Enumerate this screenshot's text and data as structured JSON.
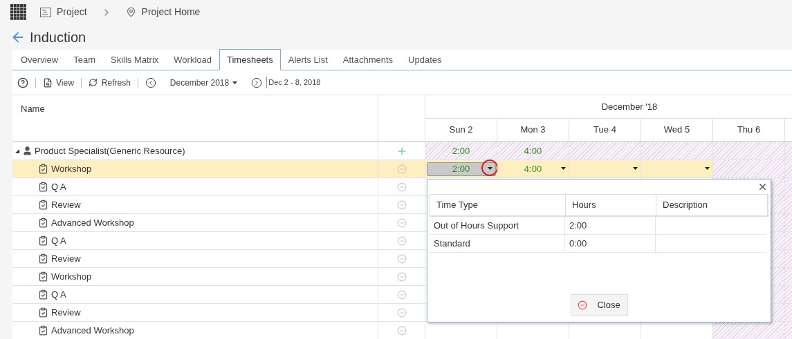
{
  "breadcrumb": [
    {
      "label": "Project",
      "kind": "project"
    },
    {
      "label": "Project Home",
      "kind": "home"
    }
  ],
  "title": "Induction",
  "tabs": [
    {
      "label": "Overview",
      "selected": false
    },
    {
      "label": "Team",
      "selected": false
    },
    {
      "label": "Skills Matrix",
      "selected": false
    },
    {
      "label": "Workload",
      "selected": false
    },
    {
      "label": "Timesheets",
      "selected": true
    },
    {
      "label": "Alerts List",
      "selected": false
    },
    {
      "label": "Attachments",
      "selected": false
    },
    {
      "label": "Updates",
      "selected": false
    }
  ],
  "toolbar": {
    "view": "View",
    "refresh": "Refresh",
    "month": "December 2018",
    "range": "Dec 2 - 8, 2018"
  },
  "grid": {
    "name_header": "Name",
    "month_header": "December '18",
    "days": [
      {
        "label": "Sun 2",
        "working": true
      },
      {
        "label": "Mon 3",
        "working": true
      },
      {
        "label": "Tue 4",
        "working": true
      },
      {
        "label": "Wed 5",
        "working": true
      },
      {
        "label": "Thu 6",
        "working": false
      }
    ],
    "rows": [
      {
        "kind": "resource",
        "name": "Product Specialist(Generic Resource)",
        "expanded": true,
        "selected": false,
        "cells": [
          {
            "value": "2:00",
            "editing": false
          },
          {
            "value": "4:00",
            "editing": false
          }
        ]
      },
      {
        "kind": "task",
        "name": "Workshop",
        "selected": true,
        "cells": [
          {
            "value": "2:00",
            "editing": true
          },
          {
            "value": "4:00",
            "editing": false
          },
          {
            "editing": false
          },
          {
            "editing": false
          }
        ]
      },
      {
        "kind": "task",
        "name": "Q A",
        "selected": false
      },
      {
        "kind": "task",
        "name": "Review",
        "selected": false
      },
      {
        "kind": "task",
        "name": "Advanced Workshop",
        "selected": false
      },
      {
        "kind": "task",
        "name": "Q A",
        "selected": false
      },
      {
        "kind": "task",
        "name": "Review",
        "selected": false
      },
      {
        "kind": "task",
        "name": "Workshop",
        "selected": false
      },
      {
        "kind": "task",
        "name": "Q A",
        "selected": false
      },
      {
        "kind": "task",
        "name": "Review",
        "selected": false
      },
      {
        "kind": "task",
        "name": "Advanced Workshop",
        "selected": false
      }
    ]
  },
  "popup": {
    "columns": [
      "Time Type",
      "Hours",
      "Description"
    ],
    "rows": [
      {
        "time_type": "Out of Hours Support",
        "hours": "2:00"
      },
      {
        "time_type": "Standard",
        "hours": "0:00"
      }
    ],
    "close": "Close"
  }
}
